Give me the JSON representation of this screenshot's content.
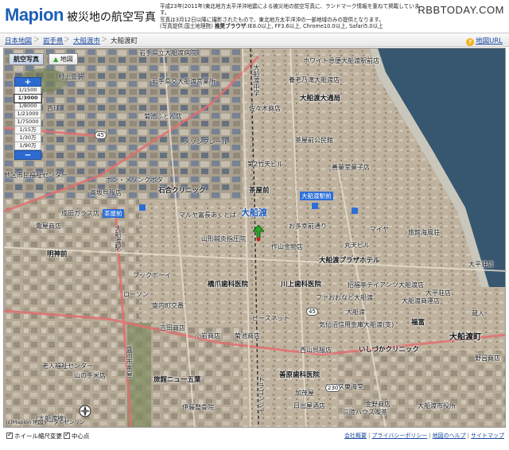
{
  "header": {
    "logo_text": "Mapion",
    "site_title": "被災地の航空写真",
    "note_line1": "平成23年(2011年)東北地方太平洋沖地震による被災地の航空写真に、ランドマーク情報を重ねて掲載しています。",
    "note_line2": "写真は3月12日以降に撮影されたもので、東北地方太平洋沖の一部地域のみの提供となります。",
    "note_source": "(写真提供:国土地理院)",
    "note_browser_label": "推奨ブラウザ",
    "note_browser_value": ":IE8.0以上, FF3.6以上, Chrome10.0以上, Safari5.0以上",
    "watermark": "RBBTODAY.COM"
  },
  "breadcrumb": {
    "items": [
      "日本地図",
      "岩手県",
      "大船渡市",
      "大船渡町"
    ],
    "separator": "＞",
    "help_label": "地図URL"
  },
  "map": {
    "tabs": [
      "航空写真",
      "地図"
    ],
    "active_tab": "航空写真",
    "zoom_plus": "+",
    "zoom_minus": "−",
    "zoom_levels": [
      "1/1500",
      "1/3000",
      "1/8000",
      "1/21000",
      "1/75000",
      "1/15万",
      "1/30万",
      "1/90万"
    ],
    "selected_zoom": "1/3000",
    "copyright": "(c)Mapion 地図データ©ゼンリン",
    "labels": {
      "l1": "岩手県立大船渡病院",
      "l2": "ホワイト急便大船渡駅前店",
      "l3": "村上畳装",
      "l4": "岩手県交大船渡営業所",
      "l5": "養老乃滝大船渡店",
      "l6": "西球",
      "l7": "佐々木商店",
      "l8": "大船渡大通局",
      "l9": "菊池ふとん店",
      "l10": "メゾンプレール",
      "l11": "茶屋前公民館",
      "l12": "第2竹天ビル",
      "l13": "善菓堂菓子店",
      "l14": "地区市民福祉センター",
      "l15": "ボン・メゾンクボタ",
      "l16": "石合クリニック",
      "l17": "茶屋前",
      "l18": "大船渡駅前",
      "l19": "高坂呉服店",
      "l20": "大船渡",
      "l21": "マルヤ富長あくとば",
      "l22": "成田ガラス店",
      "l23": "茶屋前",
      "l24": "お多幸前通り",
      "l25": "マイヤ",
      "l26": "亀屋商店",
      "l27": "大船渡駅",
      "l28": "山形鍼灸指圧院",
      "l29": "作山金物店",
      "l30": "丸天ビル",
      "l31": "旅館海風荘",
      "l32": "明神前",
      "l33": "大船渡プラザホテル",
      "l34": "大平荘店",
      "l35": "ブックボーイ",
      "l36": "橋爪歯科医院",
      "l37": "川上歯科医院",
      "l38": "招福亭テイアンツ大船渡店",
      "l39": "ローソン",
      "l40": "ファおおなど大船渡",
      "l41": "大船渡商運店",
      "l42": "盛内町交番",
      "l43": "ピースネット",
      "l44": "気仙沼信用金庫大船渡(支)",
      "l45": "福富",
      "l46": "吉田商店",
      "l47": "小岩商店",
      "l48": "菊池商店",
      "l49": "大船渡町",
      "l50": "西山呉服店",
      "l51": "いしづかクリニック",
      "l52": "野呂商店",
      "l53": "老人福祉センター",
      "l54": "旅館ニュー五葉",
      "l55": "善原歯科医院",
      "l56": "山の手米店",
      "l57": "エビス東海堂",
      "l58": "加茂屋",
      "l59": "伊藤整骨院",
      "l60": "日出屋酒店",
      "l61": "金野商店",
      "l62": "大船渡市役所",
      "l63": "三陸ハウス喫茶",
      "l64": "大船渡中学",
      "l65": "蔵人",
      "l66": "ドラゴンジャ",
      "l67": "(大船渡線)",
      "l68": "盛岡市茶屋",
      "l69": "大平荘店",
      "l70": "大船渡"
    },
    "route_numbers": [
      "45",
      "45",
      "230"
    ]
  },
  "footer": {
    "checkbox1_label": "ホイール縮尺変更",
    "checkbox2_label": "中心点",
    "links": [
      "会社概要",
      "プライバシーポリシー",
      "地図のヘルプ",
      "サイトマップ"
    ]
  },
  "colors": {
    "brand": "#1d5fb5",
    "zoom_blue": "#2d6bd2",
    "pin_green": "#2ba52b",
    "road_pink": "#e07070",
    "sea": "#37566f"
  }
}
